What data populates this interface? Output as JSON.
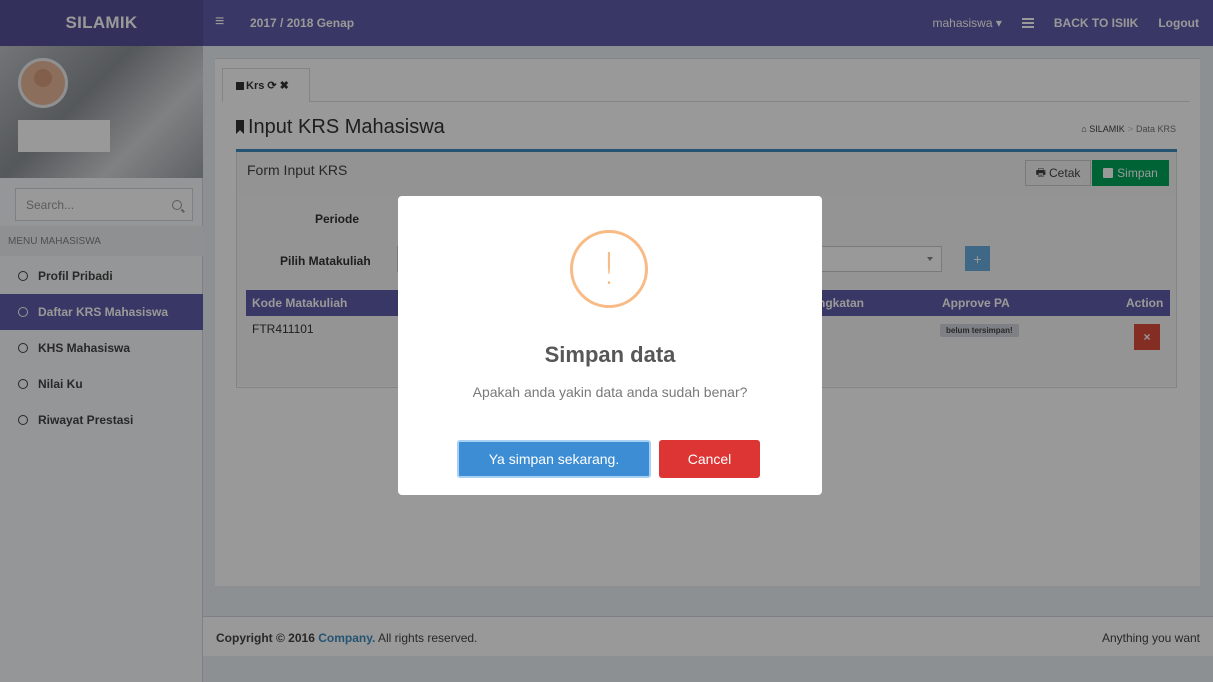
{
  "topbar": {
    "logo": "SILAMIK",
    "menu_toggle": "≡",
    "period": "2017 / 2018 Genap",
    "user": "mahasiswa ▾",
    "back": "BACK TO ISIIK",
    "logout": "Logout"
  },
  "sidebar": {
    "search_placeholder": "Search...",
    "menu_header": "MENU MAHASISWA",
    "items": [
      {
        "label": "Profil Pribadi"
      },
      {
        "label": "Daftar KRS Mahasiswa"
      },
      {
        "label": "KHS Mahasiswa"
      },
      {
        "label": "Nilai Ku"
      },
      {
        "label": "Riwayat Prestasi"
      }
    ]
  },
  "tab": {
    "label": "Krs",
    "icons": "⟳ ✖"
  },
  "page": {
    "title": "Input KRS Mahasiswa",
    "breadcrumb": [
      "SILAMIK",
      "Data KRS"
    ]
  },
  "form": {
    "title": "Form Input KRS",
    "cetak_label": "Cetak",
    "simpan_label": "Simpan",
    "periode_label": "Periode",
    "pilih_label": "Pilih Matakuliah",
    "add_label": "+",
    "columns": [
      "Kode Matakuliah",
      "ngkatan",
      "Approve PA",
      "Action"
    ],
    "row": {
      "code": "FTR411101",
      "status": "belum tersimpan!",
      "action": "×"
    }
  },
  "footer": {
    "prefix": "Copyright © 2016",
    "company": "Company.",
    "suffix": "All rights reserved.",
    "right": "Anything you want"
  },
  "modal": {
    "icon_glyph": "!",
    "title": "Simpan data",
    "text": "Apakah anda yakin data anda sudah benar?",
    "confirm": "Ya simpan sekarang.",
    "cancel": "Cancel"
  },
  "colors": {
    "brand": "#605ca8",
    "success": "#00a65a",
    "danger": "#dd4b39",
    "primary": "#3c8dbc",
    "warning": "#f8bb86"
  }
}
